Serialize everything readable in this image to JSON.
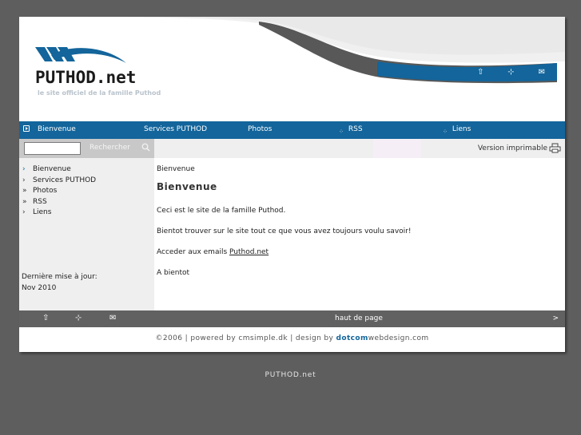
{
  "site": {
    "logo_text": "PUTHOD.net",
    "tagline": "le site officiel de la famille Puthod",
    "bottom_title": "PUTHOD.net"
  },
  "top_icons": [
    {
      "icon": "home-icon",
      "glyph": "⇧"
    },
    {
      "icon": "sitemap-icon",
      "glyph": "⊹"
    },
    {
      "icon": "mail-icon",
      "glyph": "✉"
    }
  ],
  "nav": {
    "items": [
      "Bienvenue",
      "Services PUTHOD",
      "Photos",
      "RSS",
      "Liens"
    ]
  },
  "search": {
    "value": "",
    "button_label": "Rechercher"
  },
  "print": {
    "label": "Version imprimable"
  },
  "sidebar": {
    "items": [
      "Bienvenue",
      "Services PUTHOD",
      "Photos",
      "RSS",
      "Liens"
    ],
    "update_label": "Dernière mise à jour:",
    "update_value": "Nov 2010"
  },
  "main": {
    "breadcrumb": "Bienvenue",
    "title": "Bienvenue",
    "p1": "Ceci est le site de la famille Puthod.",
    "p2": "Bientot trouver sur le site tout ce que vous avez toujours voulu savoir!",
    "p3_prefix": "Acceder aux emails ",
    "p3_link": "Puthod.net",
    "p4": "A bientot"
  },
  "footer": {
    "top_link": "haut de page",
    "next": ">",
    "credits_prefix": "©2006 | powered by cmsimple.dk | design by ",
    "credits_brand": "dotcom",
    "credits_suffix": "webdesign.com"
  },
  "colors": {
    "accent": "#13659b",
    "background": "#5e5e5e",
    "footer_bar": "#616161",
    "sidebar": "#efefef"
  }
}
